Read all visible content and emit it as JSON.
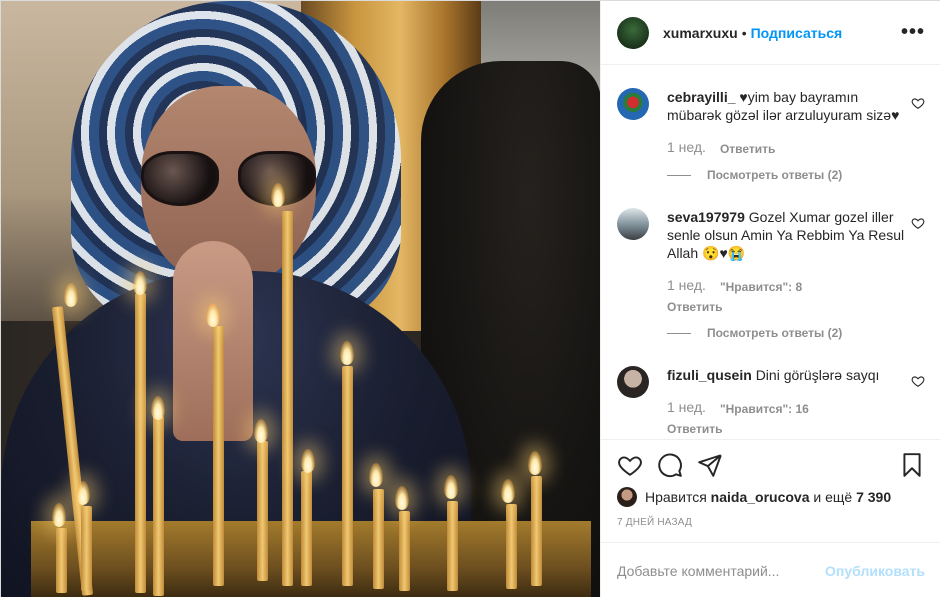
{
  "post": {
    "image_alt": "Woman in a patterned headscarf and sunglasses praying before lit candles",
    "author": "xumarxuxu",
    "follow_separator": "•",
    "follow_label": "Подписаться",
    "more_label": "•••"
  },
  "comments": [
    {
      "user": "cebrayilli_",
      "text": "♥yim bay bayramın mübarək gözəl ilər arzuluyuram sizə♥",
      "time": "1 нед.",
      "reply_label": "Ответить",
      "likes": "",
      "view_replies": "Посмотреть ответы (2)"
    },
    {
      "user": "seva197979",
      "text": "Gozel Xumar gozel iller senle olsun Amin Ya Rebbim Ya Resul Allah 😯♥😭",
      "time": "1 нед.",
      "likes": "\"Нравится\": 8",
      "reply_label": "Ответить",
      "view_replies": "Посмотреть ответы (2)"
    },
    {
      "user": "fizuli_qusein",
      "text": "Dini görüşlərə sayqı",
      "time": "1 нед.",
      "likes": "\"Нравится\": 16",
      "reply_label": "Ответить",
      "view_replies": ""
    }
  ],
  "actions": {
    "likes_prefix": "Нравится",
    "liker": "naida_orucova",
    "likes_suffix_word": "и ещё",
    "likes_count": "7 390",
    "date": "7 ДНЕЙ НАЗАД"
  },
  "composer": {
    "placeholder": "Добавьте комментарий...",
    "publish_label": "Опубликовать"
  },
  "colors": {
    "accent": "#0095f6",
    "publish_disabled": "#b2dffc",
    "muted": "#8e8e8e"
  },
  "icons": [
    "heart-icon",
    "comment-icon",
    "share-icon",
    "bookmark-icon",
    "more-icon"
  ]
}
